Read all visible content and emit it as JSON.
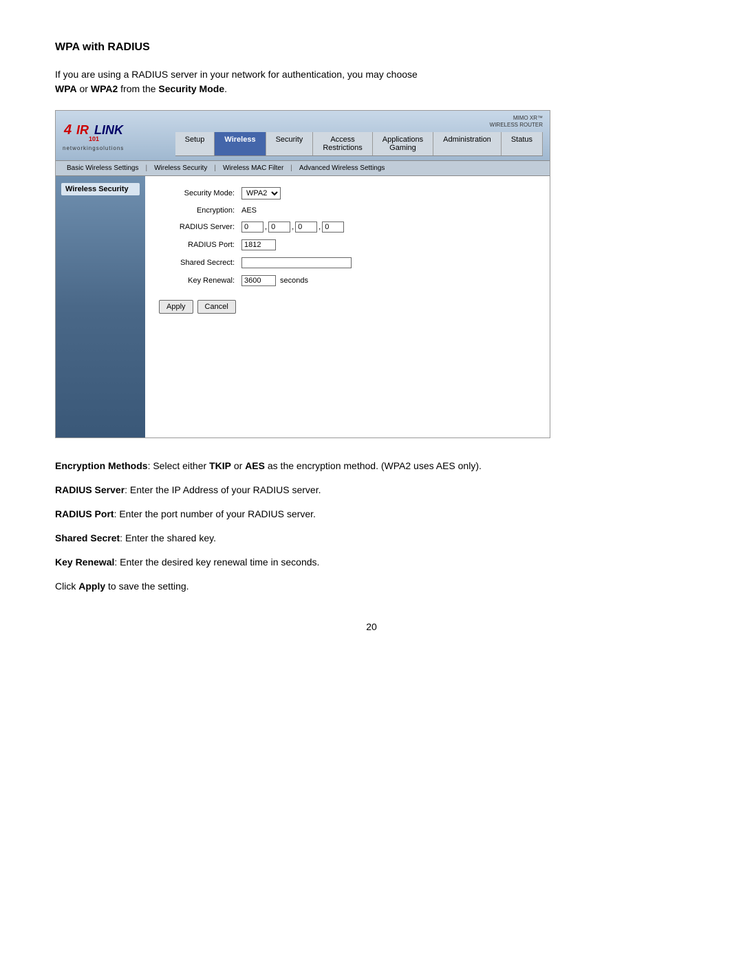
{
  "page": {
    "title": "WPA with RADIUS",
    "intro_line1": "If you are using a RADIUS server in your network for authentication, you may choose",
    "intro_bold1": "WPA",
    "intro_text2": " or ",
    "intro_bold2": "WPA2",
    "intro_text3": " from the ",
    "intro_bold3": "Security Mode",
    "intro_text4": ".",
    "page_number": "20"
  },
  "router": {
    "brand": "MIMO XR™\nWIRELESS ROUTER",
    "logo_main": "4IRLINK",
    "logo_sub": "networkingsolutions",
    "nav_tabs": [
      {
        "label": "Setup",
        "active": false
      },
      {
        "label": "Wireless",
        "active": true
      },
      {
        "label": "Security",
        "active": false
      },
      {
        "label": "Access\nRestrictions",
        "active": false
      },
      {
        "label": "Applications\nGaming",
        "active": false
      },
      {
        "label": "Administration",
        "active": false
      },
      {
        "label": "Status",
        "active": false
      }
    ],
    "sub_nav": [
      {
        "label": "Basic Wireless Settings"
      },
      {
        "label": "Wireless Security"
      },
      {
        "label": "Wireless MAC Filter"
      },
      {
        "label": "Advanced Wireless Settings"
      }
    ],
    "sidebar_title": "Wireless Security",
    "form": {
      "security_mode_label": "Security Mode:",
      "security_mode_value": "WPA2",
      "encryption_label": "Encryption:",
      "encryption_value": "AES",
      "radius_server_label": "RADIUS Server:",
      "radius_octet1": "0",
      "radius_octet2": "0",
      "radius_octet3": "0",
      "radius_octet4": "0",
      "radius_port_label": "RADIUS Port:",
      "radius_port_value": "1812",
      "shared_secret_label": "Shared Secrect:",
      "shared_secret_value": "",
      "key_renewal_label": "Key Renewal:",
      "key_renewal_value": "3600",
      "seconds_label": "seconds"
    },
    "buttons": {
      "apply": "Apply",
      "cancel": "Cancel"
    }
  },
  "descriptions": [
    {
      "bold_prefix": "Encryption Methods",
      "text": ": Select either ",
      "bold1": "TKIP",
      "text2": " or ",
      "bold2": "AES",
      "text3": " as the encryption method. (WPA2 uses AES only)."
    },
    {
      "bold_prefix": "RADIUS Server",
      "text": ": Enter the IP Address of your RADIUS server."
    },
    {
      "bold_prefix": "RADIUS Port",
      "text": ": Enter the port number of your RADIUS server."
    },
    {
      "bold_prefix": "Shared Secret",
      "text": ": Enter the shared key."
    },
    {
      "bold_prefix": "Key Renewal",
      "text": ": Enter the desired key renewal time in seconds."
    },
    {
      "text_prefix": "Click ",
      "bold": "Apply",
      "text_suffix": " to save the setting."
    }
  ]
}
